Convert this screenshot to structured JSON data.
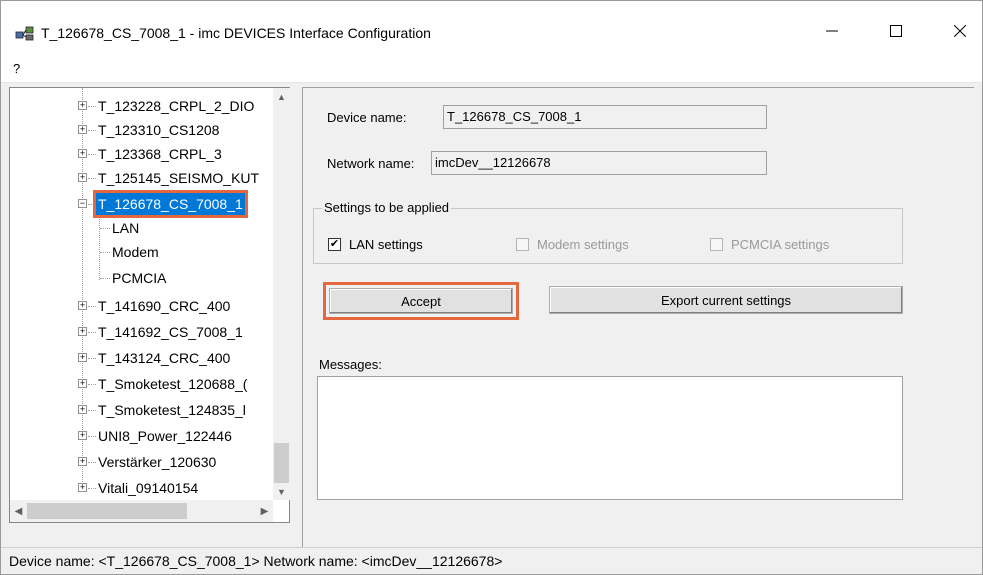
{
  "window": {
    "title": "T_126678_CS_7008_1 - imc DEVICES Interface Configuration",
    "menu": [
      "?"
    ]
  },
  "tree": {
    "items": [
      {
        "label": "T_123228_CRPL_2_DIO",
        "level": 0,
        "expandable": true
      },
      {
        "label": "T_123310_CS1208",
        "level": 0,
        "expandable": true
      },
      {
        "label": "T_123368_CRPL_3",
        "level": 0,
        "expandable": true
      },
      {
        "label": "T_125145_SEISMO_KUT",
        "level": 0,
        "expandable": true
      },
      {
        "label": "T_126678_CS_7008_1",
        "level": 0,
        "expandable": true,
        "expanded": true,
        "selected": true
      },
      {
        "label": "LAN",
        "level": 1,
        "expandable": false
      },
      {
        "label": "Modem",
        "level": 1,
        "expandable": false
      },
      {
        "label": "PCMCIA",
        "level": 1,
        "expandable": false
      },
      {
        "label": "T_141690_CRC_400",
        "level": 0,
        "expandable": true
      },
      {
        "label": "T_141692_CS_7008_1",
        "level": 0,
        "expandable": true
      },
      {
        "label": "T_143124_CRC_400",
        "level": 0,
        "expandable": true
      },
      {
        "label": "T_Smoketest_120688_(",
        "level": 0,
        "expandable": true
      },
      {
        "label": "T_Smoketest_124835_l",
        "level": 0,
        "expandable": true
      },
      {
        "label": "UNI8_Power_122446",
        "level": 0,
        "expandable": true
      },
      {
        "label": "Verstärker_120630",
        "level": 0,
        "expandable": true
      },
      {
        "label": "Vitali_09140154",
        "level": 0,
        "expandable": true
      }
    ]
  },
  "details": {
    "device_name_label": "Device name:",
    "device_name_value": "T_126678_CS_7008_1",
    "network_name_label": "Network name:",
    "network_name_value": "imcDev__12126678",
    "settings_group_title": "Settings to be applied",
    "checkboxes": [
      {
        "label": "LAN settings",
        "checked": true,
        "enabled": true
      },
      {
        "label": "Modem settings",
        "checked": false,
        "enabled": false
      },
      {
        "label": "PCMCIA settings",
        "checked": false,
        "enabled": false
      }
    ],
    "accept_label": "Accept",
    "export_label": "Export current settings",
    "messages_label": "Messages:"
  },
  "status": {
    "text": "Device name: <T_126678_CS_7008_1> Network name: <imcDev__12126678>"
  },
  "colors": {
    "selection": "#0078d7",
    "highlight_outline": "#e4683e"
  }
}
